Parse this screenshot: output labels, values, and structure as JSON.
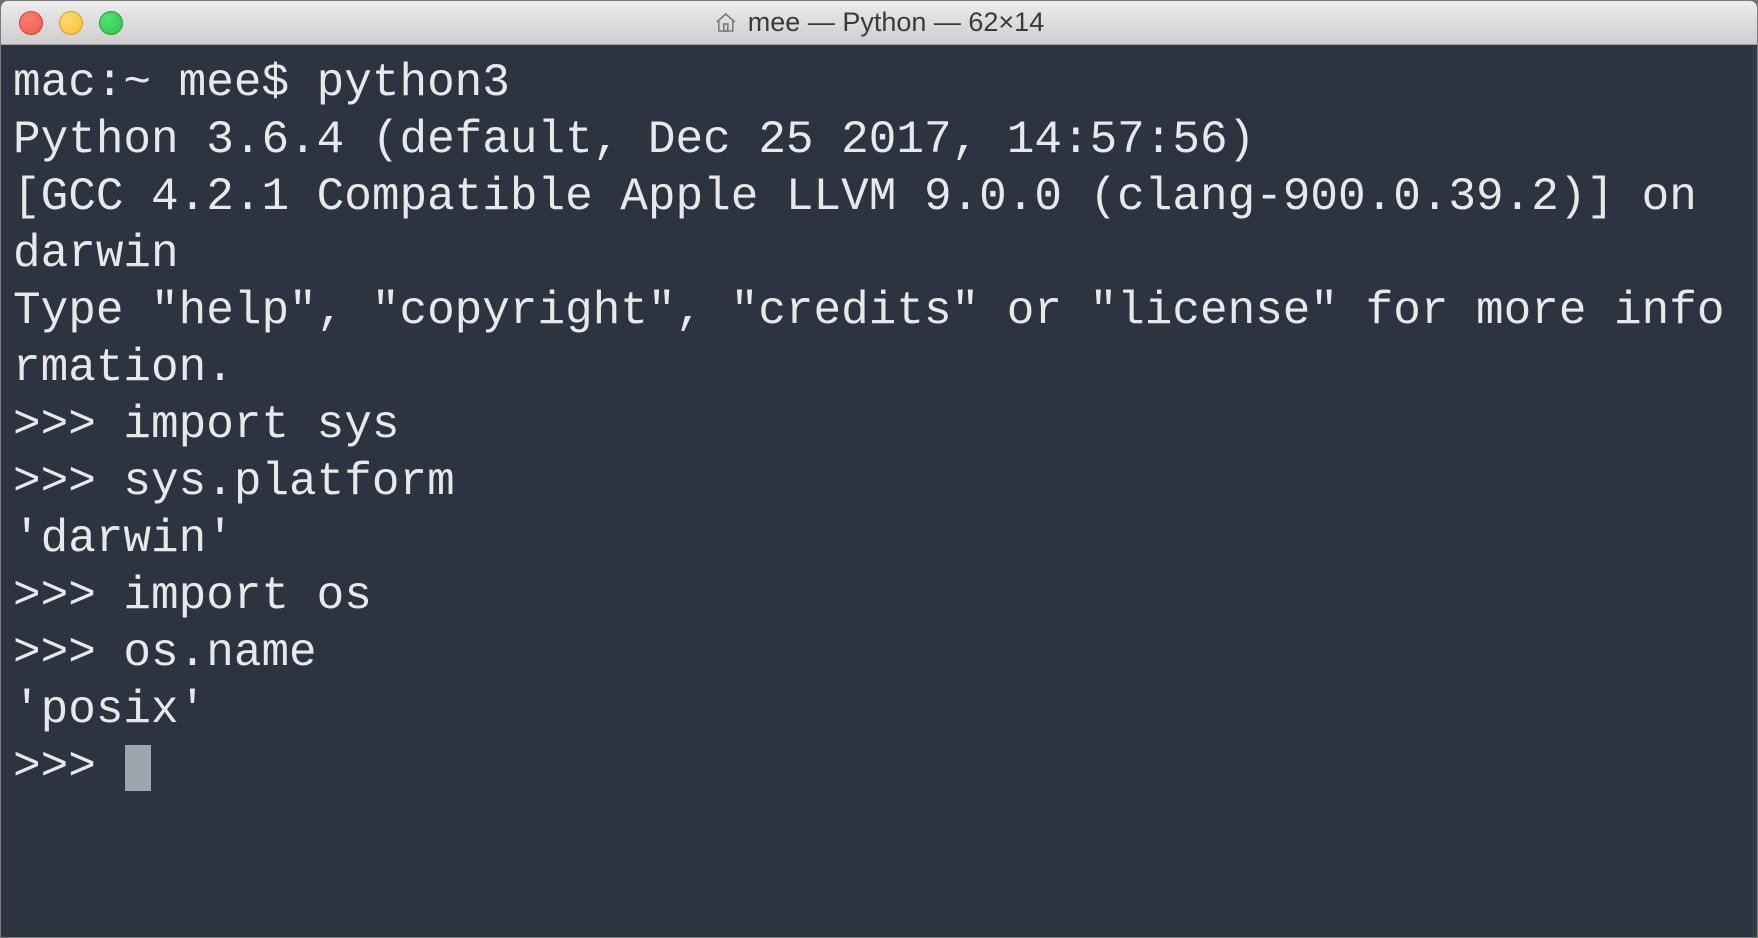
{
  "window": {
    "title": "mee — Python — 62×14"
  },
  "terminal": {
    "lines": [
      "mac:~ mee$ python3",
      "Python 3.6.4 (default, Dec 25 2017, 14:57:56) ",
      "[GCC 4.2.1 Compatible Apple LLVM 9.0.0 (clang-900.0.39.2)] on darwin",
      "Type \"help\", \"copyright\", \"credits\" or \"license\" for more information.",
      ">>> import sys",
      ">>> sys.platform",
      "'darwin'",
      ">>> import os",
      ">>> os.name",
      "'posix'",
      ">>> "
    ]
  }
}
